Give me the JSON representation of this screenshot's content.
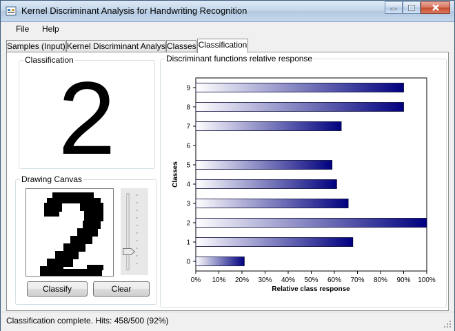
{
  "window": {
    "title": "Kernel Discriminant Analysis for Handwriting Recognition"
  },
  "menu": {
    "file": "File",
    "help": "Help"
  },
  "tabs": [
    {
      "label": "Samples (Input)"
    },
    {
      "label": "Kernel Discriminant Analysis"
    },
    {
      "label": "Classes"
    },
    {
      "label": "Classification"
    }
  ],
  "classification": {
    "group_label": "Classification",
    "result": "2"
  },
  "drawing": {
    "group_label": "Drawing Canvas",
    "classify_label": "Classify",
    "clear_label": "Clear",
    "slider_level": 0.25
  },
  "chart_panel": {
    "group_label": "Discriminant functions relative response"
  },
  "chart_data": {
    "type": "bar",
    "orientation": "horizontal",
    "categories": [
      "0",
      "1",
      "2",
      "3",
      "4",
      "5",
      "6",
      "7",
      "8",
      "9"
    ],
    "values": [
      0.21,
      0.68,
      1.0,
      0.66,
      0.61,
      0.59,
      0.0,
      0.63,
      0.9,
      0.9
    ],
    "xlabel": "Relative class response",
    "ylabel": "Classes",
    "xlim": [
      0,
      1
    ],
    "x_ticks": [
      "0%",
      "10%",
      "20%",
      "30%",
      "40%",
      "50%",
      "60%",
      "70%",
      "80%",
      "90%",
      "100%"
    ],
    "bar_gradient": [
      "#ffffff",
      "#00007f"
    ],
    "grid": false
  },
  "status": {
    "text": "Classification complete. Hits: 458/500 (92%)"
  },
  "colors": {
    "bar_end": "#00007f",
    "bar_border": "#000033"
  }
}
